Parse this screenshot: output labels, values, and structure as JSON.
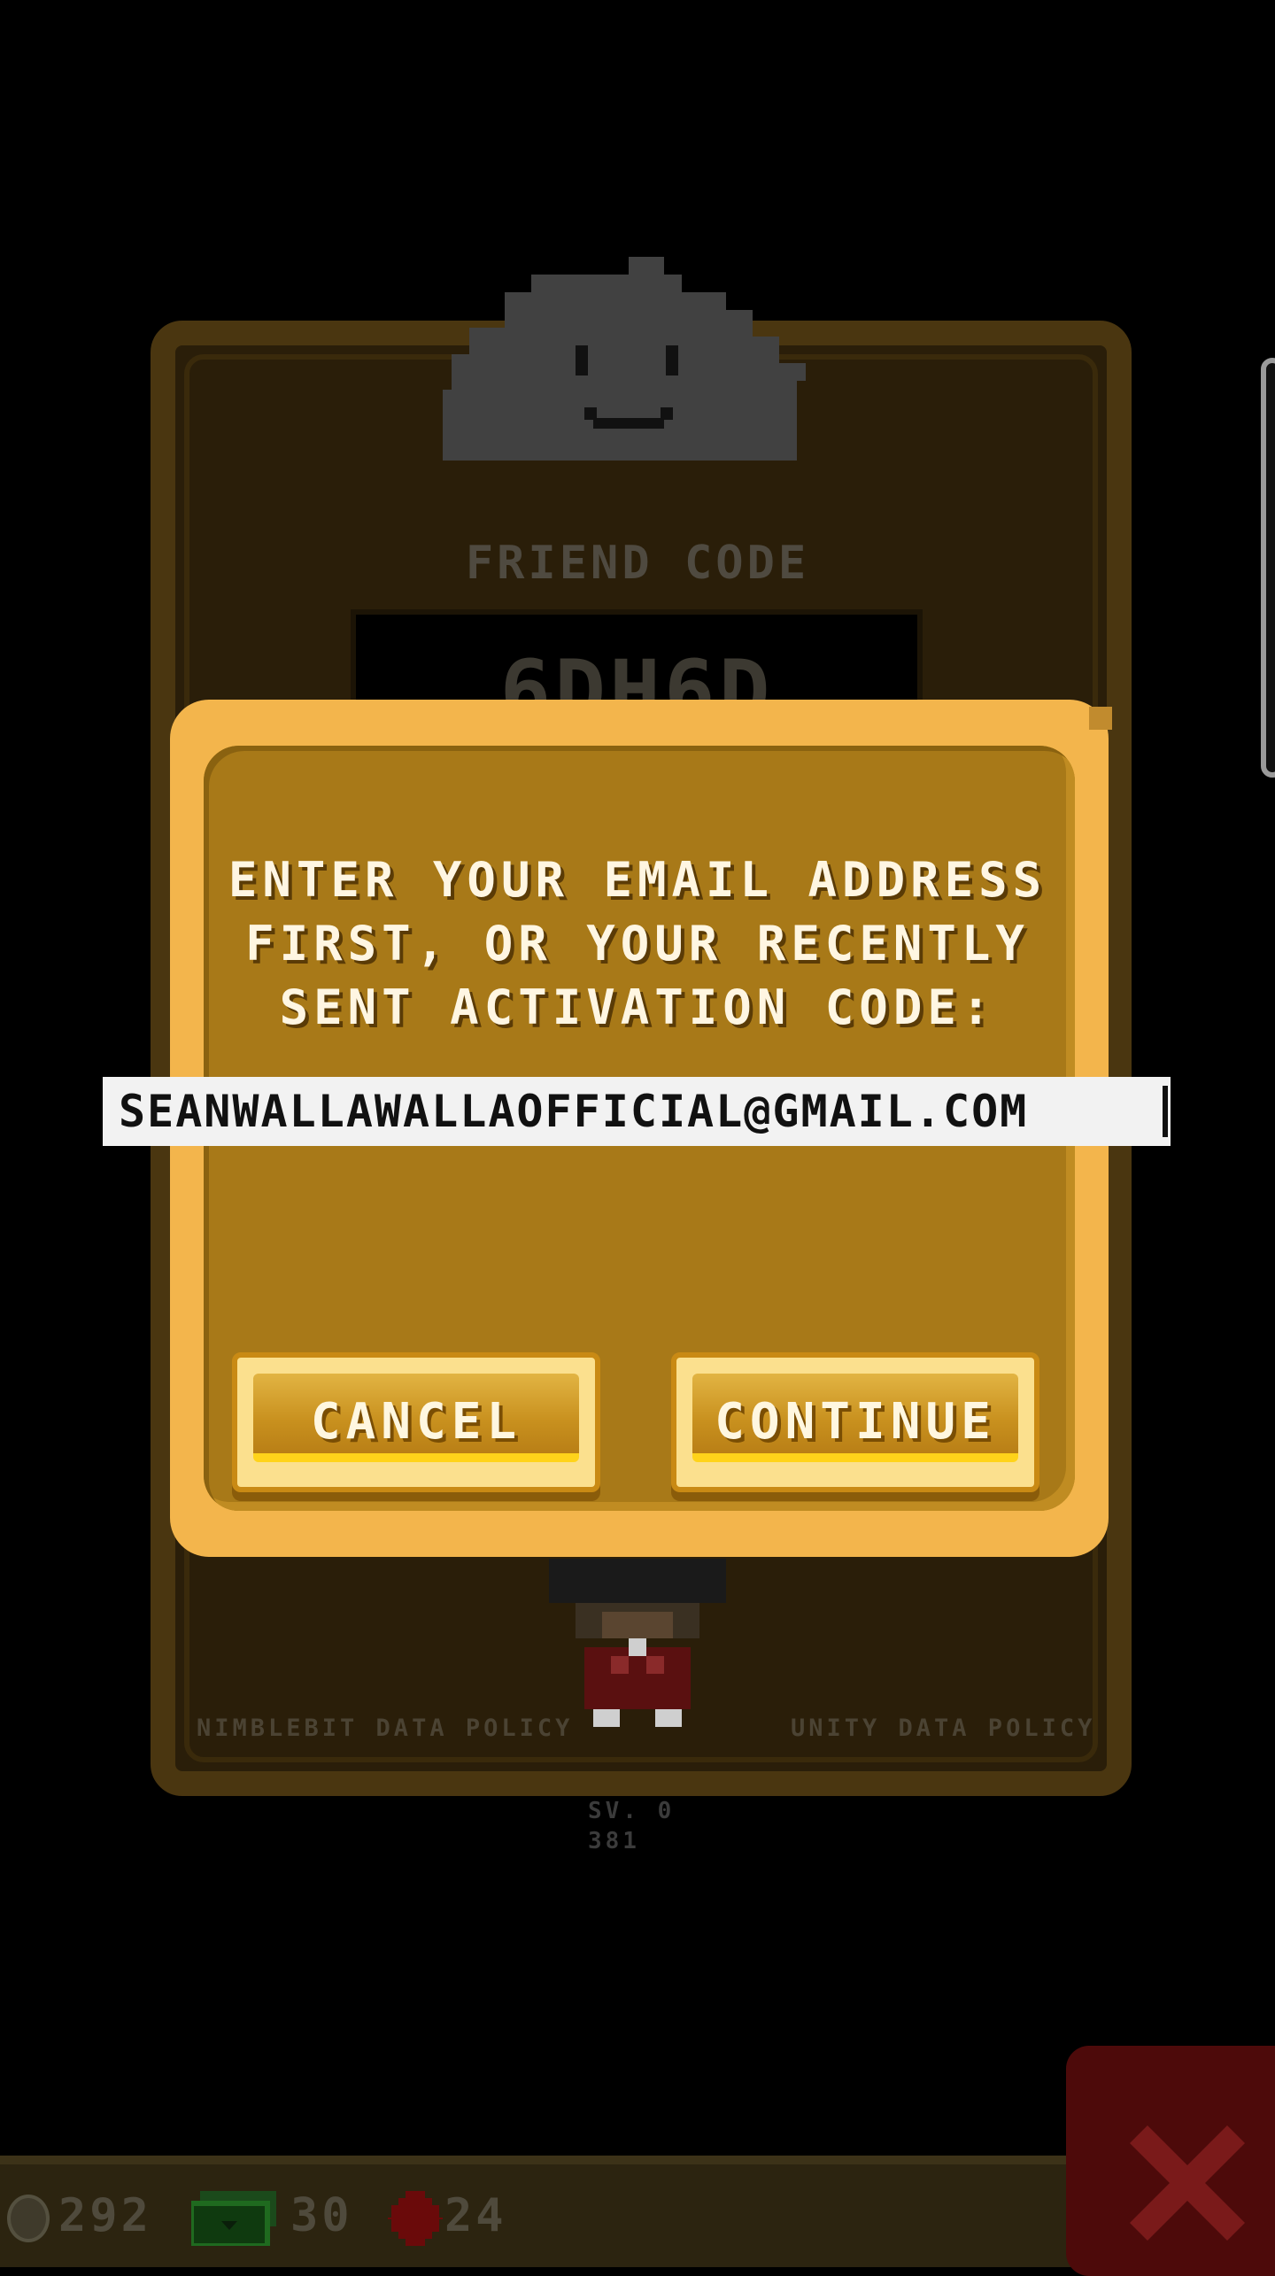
{
  "background": {
    "friend_code_label": "FRIEND CODE",
    "friend_code_value": "6DH6D",
    "policy_left": "NIMBLEBIT DATA POLICY",
    "policy_right": "UNITY DATA POLICY",
    "version_line1": "SV. 0",
    "version_line2": "381"
  },
  "dialog": {
    "prompt_line1": "ENTER YOUR EMAIL ADDRESS",
    "prompt_line2": "FIRST, OR YOUR RECENTLY",
    "prompt_line3": "SENT ACTIVATION CODE:",
    "email_value": "SEANWALLAWALLAOFFICIAL@GMAIL.COM",
    "cancel_label": "CANCEL",
    "continue_label": "CONTINUE"
  },
  "stats": {
    "coins": "292",
    "bux": "30",
    "gems": "24"
  },
  "icons": [
    "cloud-icon",
    "character-sprite",
    "coin-icon",
    "bux-icon",
    "gem-icon",
    "close-icon"
  ],
  "colors": {
    "dialog_outer": "#f3b54c",
    "dialog_inner": "#a87918",
    "close_bg": "#4d0a0a"
  }
}
